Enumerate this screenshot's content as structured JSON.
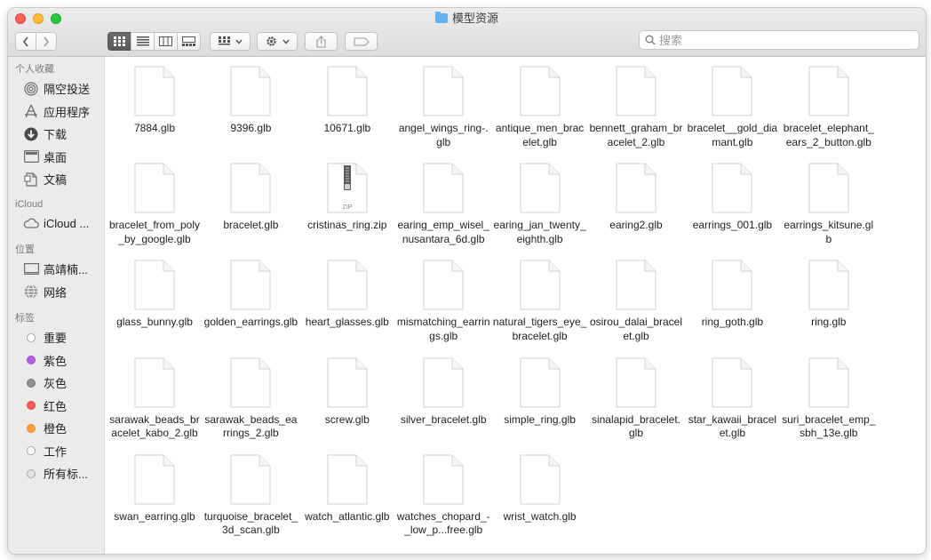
{
  "window": {
    "title": "模型资源",
    "search_placeholder": "搜索"
  },
  "sidebar": {
    "favorites_header": "个人收藏",
    "favorites": [
      {
        "label": "隔空投送",
        "icon": "airdrop-icon"
      },
      {
        "label": "应用程序",
        "icon": "applications-icon"
      },
      {
        "label": "下载",
        "icon": "download-icon"
      },
      {
        "label": "桌面",
        "icon": "desktop-icon"
      },
      {
        "label": "文稿",
        "icon": "documents-icon"
      }
    ],
    "icloud_header": "iCloud",
    "icloud": [
      {
        "label": "iCloud ...",
        "icon": "cloud-icon"
      }
    ],
    "locations_header": "位置",
    "locations": [
      {
        "label": "高靖楠...",
        "icon": "computer-icon"
      },
      {
        "label": "网络",
        "icon": "network-icon"
      }
    ],
    "tags_header": "标签",
    "tags": [
      {
        "label": "重要",
        "color": "#ffffff",
        "border": "#a6a6a6"
      },
      {
        "label": "紫色",
        "color": "#b35fe0",
        "border": "#9c4fcc"
      },
      {
        "label": "灰色",
        "color": "#8e8e93",
        "border": "#7a7a7f"
      },
      {
        "label": "红色",
        "color": "#fc5a52",
        "border": "#e24b44"
      },
      {
        "label": "橙色",
        "color": "#fd9f38",
        "border": "#e88d2c"
      },
      {
        "label": "工作",
        "color": "#ffffff",
        "border": "#a6a6a6"
      },
      {
        "label": "所有标...",
        "color": "#e3e3e3",
        "border": "#a6a6a6"
      }
    ]
  },
  "files": [
    {
      "name": "7884.glb",
      "type": "doc"
    },
    {
      "name": "9396.glb",
      "type": "doc"
    },
    {
      "name": "10671.glb",
      "type": "doc"
    },
    {
      "name": "angel_wings_ring-.glb",
      "type": "doc"
    },
    {
      "name": "antique_men_bracelet.glb",
      "type": "doc"
    },
    {
      "name": "bennett_graham_bracelet_2.glb",
      "type": "doc"
    },
    {
      "name": "bracelet__gold_diamant.glb",
      "type": "doc"
    },
    {
      "name": "bracelet_elephant_ears_2_button.glb",
      "type": "doc"
    },
    {
      "name": "bracelet_from_poly_by_google.glb",
      "type": "doc"
    },
    {
      "name": "bracelet.glb",
      "type": "doc"
    },
    {
      "name": "cristinas_ring.zip",
      "type": "zip",
      "badge": "ZIP"
    },
    {
      "name": "earing_emp_wisel_nusantara_6d.glb",
      "type": "doc"
    },
    {
      "name": "earing_jan_twenty_eighth.glb",
      "type": "doc"
    },
    {
      "name": "earing2.glb",
      "type": "doc"
    },
    {
      "name": "earrings_001.glb",
      "type": "doc"
    },
    {
      "name": "earrings_kitsune.glb",
      "type": "doc"
    },
    {
      "name": "glass_bunny.glb",
      "type": "doc"
    },
    {
      "name": "golden_earrings.glb",
      "type": "doc"
    },
    {
      "name": "heart_glasses.glb",
      "type": "doc"
    },
    {
      "name": "mismatching_earrings.glb",
      "type": "doc"
    },
    {
      "name": "natural_tigers_eye_bracelet.glb",
      "type": "doc"
    },
    {
      "name": "osirou_dalai_bracelet.glb",
      "type": "doc"
    },
    {
      "name": "ring_goth.glb",
      "type": "doc"
    },
    {
      "name": "ring.glb",
      "type": "doc"
    },
    {
      "name": "sarawak_beads_bracelet_kabo_2.glb",
      "type": "doc"
    },
    {
      "name": "sarawak_beads_earrings_2.glb",
      "type": "doc"
    },
    {
      "name": "screw.glb",
      "type": "doc"
    },
    {
      "name": "silver_bracelet.glb",
      "type": "doc"
    },
    {
      "name": "simple_ring.glb",
      "type": "doc"
    },
    {
      "name": "sinalapid_bracelet.glb",
      "type": "doc"
    },
    {
      "name": "star_kawaii_bracelet.glb",
      "type": "doc"
    },
    {
      "name": "suri_bracelet_emp_sbh_13e.glb",
      "type": "doc"
    },
    {
      "name": "swan_earring.glb",
      "type": "doc"
    },
    {
      "name": "turquoise_bracelet_3d_scan.glb",
      "type": "doc"
    },
    {
      "name": "watch_atlantic.glb",
      "type": "doc"
    },
    {
      "name": "watches_chopard_-_low_p...free.glb",
      "type": "doc"
    },
    {
      "name": "wrist_watch.glb",
      "type": "doc"
    }
  ]
}
